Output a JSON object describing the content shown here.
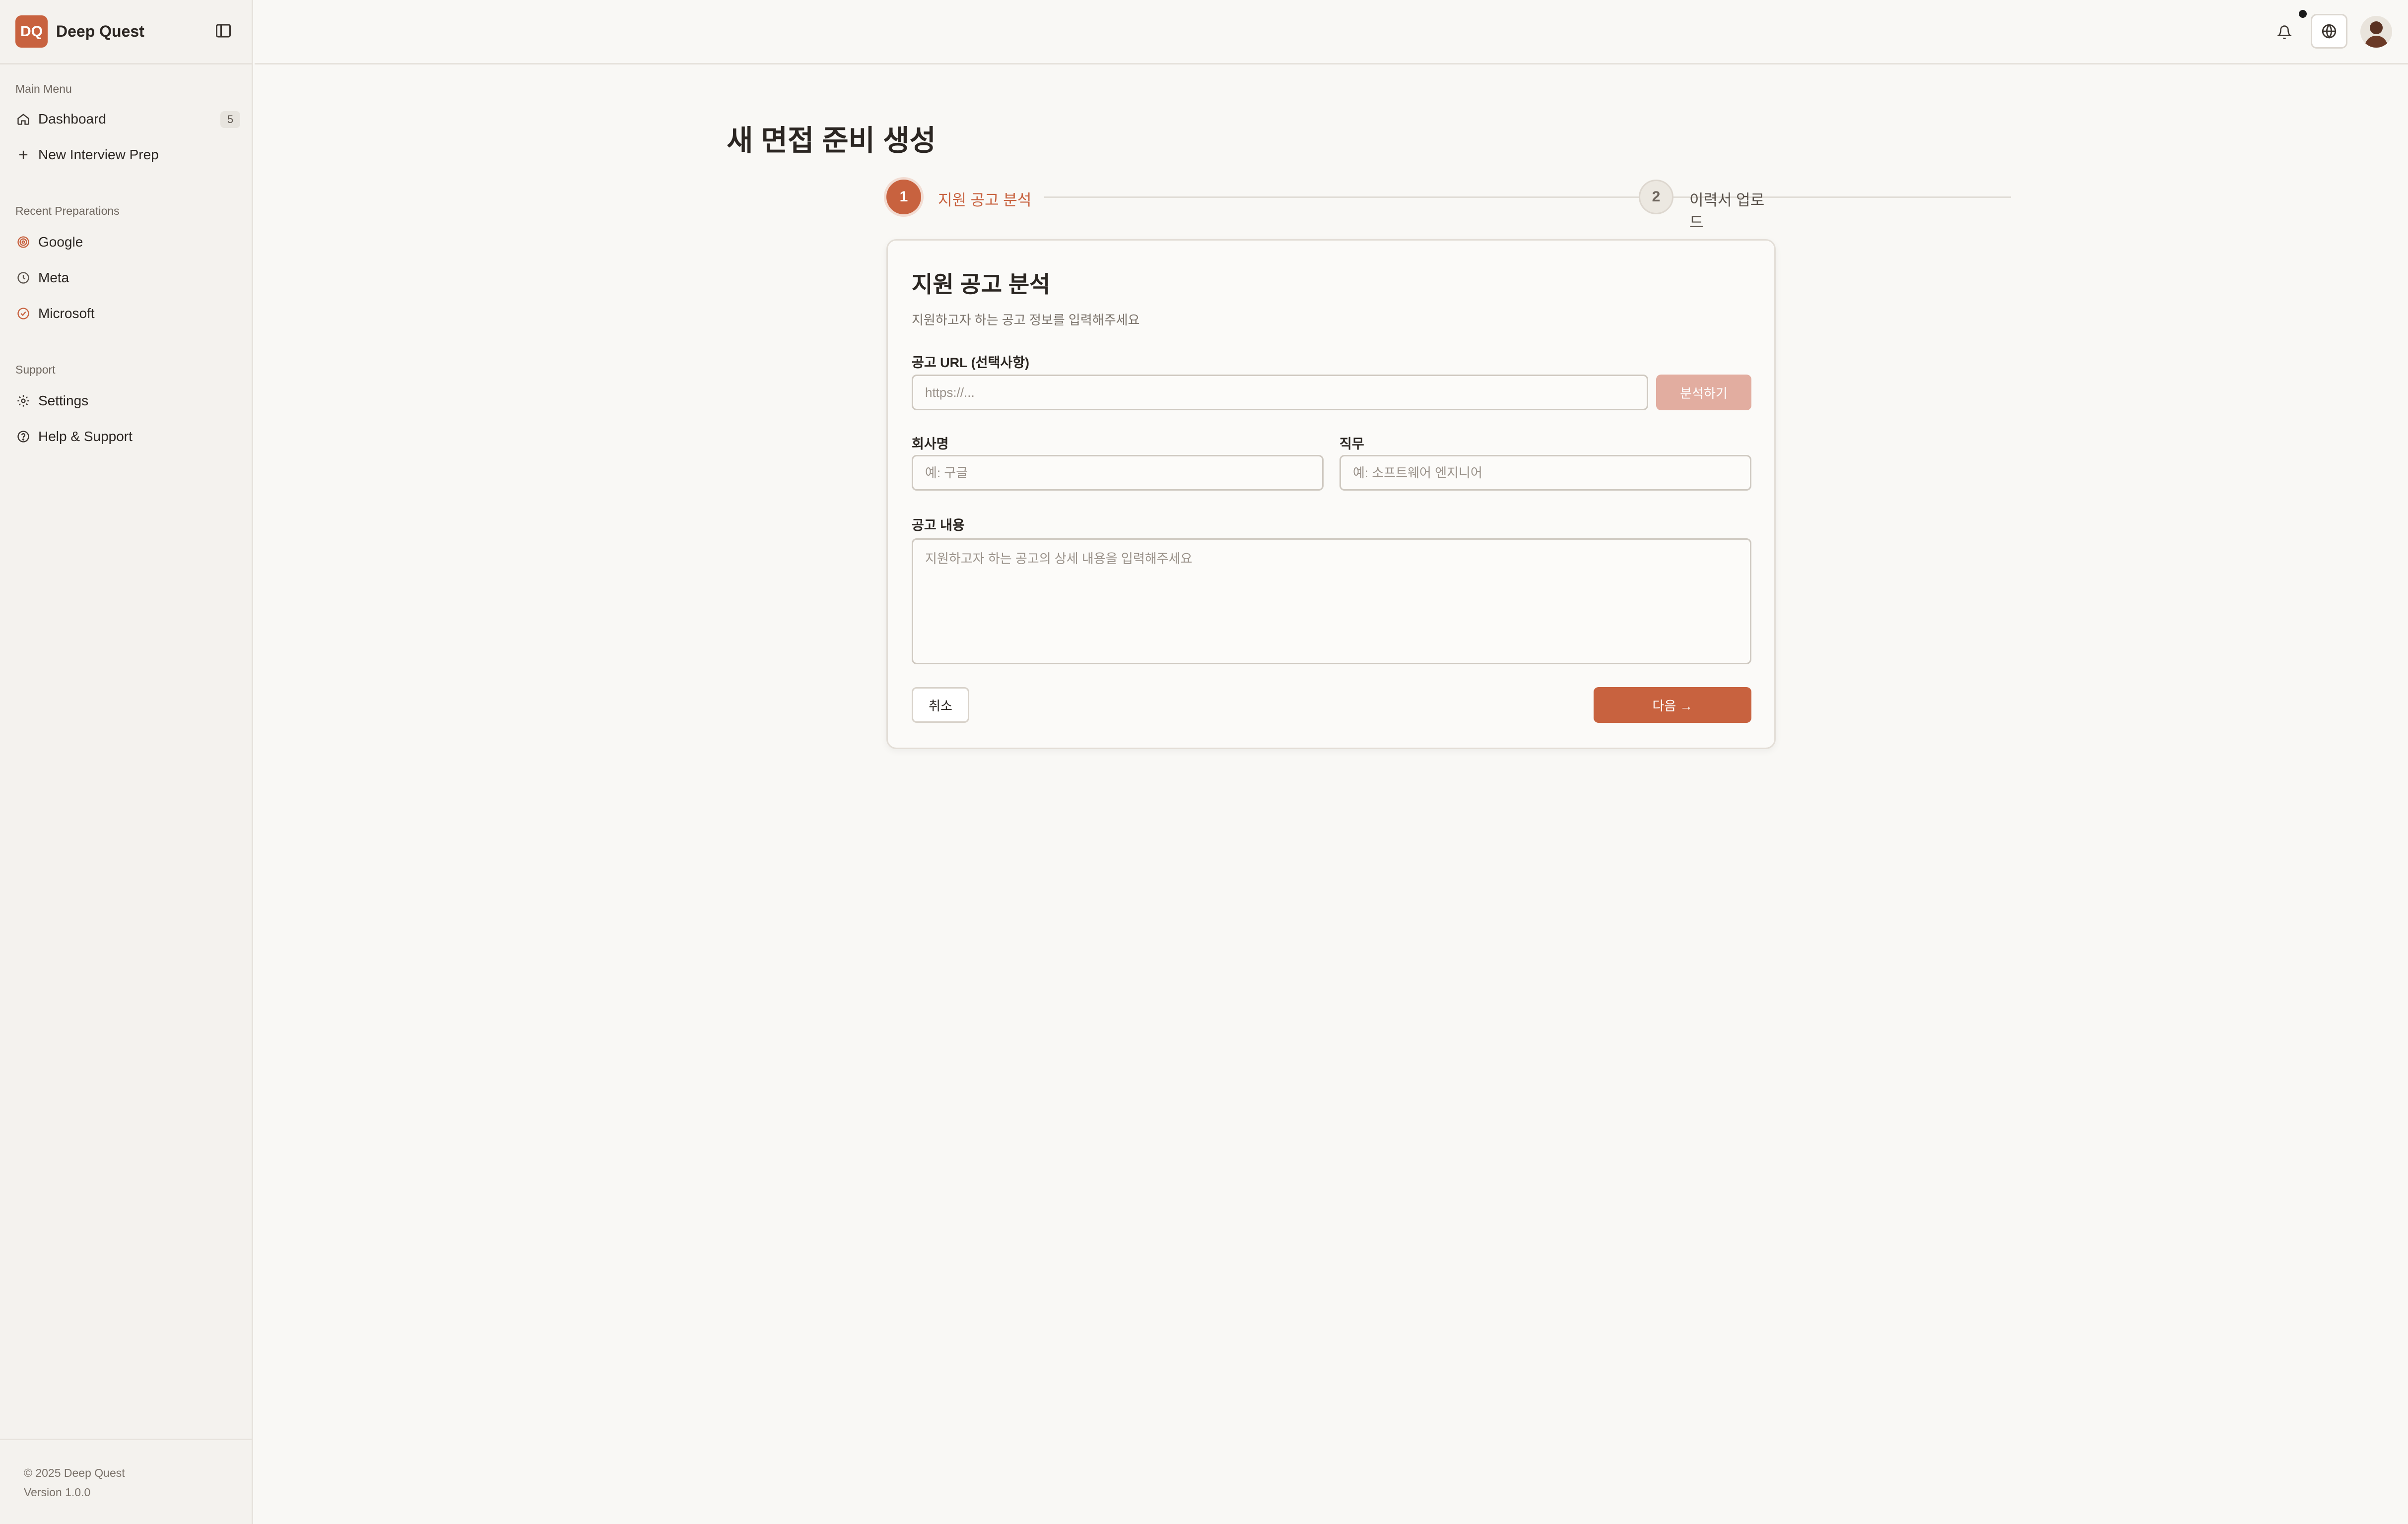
{
  "brand": {
    "logo": "DQ",
    "name": "Deep Quest"
  },
  "sidebar": {
    "main_menu_label": "Main Menu",
    "main_items": [
      {
        "label": "Dashboard",
        "icon": "home-icon",
        "badge": "5"
      },
      {
        "label": "New Interview Prep",
        "icon": "plus-icon"
      }
    ],
    "recent_label": "Recent Preparations",
    "recent_items": [
      {
        "label": "Google",
        "icon": "target-icon"
      },
      {
        "label": "Meta",
        "icon": "clock-icon"
      },
      {
        "label": "Microsoft",
        "icon": "check-circle-icon"
      }
    ],
    "support_label": "Support",
    "support_items": [
      {
        "label": "Settings",
        "icon": "gear-icon"
      },
      {
        "label": "Help & Support",
        "icon": "help-circle-icon"
      }
    ],
    "footer": {
      "copyright": "© 2025 Deep Quest",
      "version": "Version 1.0.0"
    }
  },
  "header": {
    "icons": [
      "bell-icon",
      "globe-icon",
      "avatar"
    ]
  },
  "main": {
    "title": "새 면접 준비 생성",
    "steps": [
      {
        "number": "1",
        "label": "지원 공고 분석",
        "state": "active"
      },
      {
        "number": "2",
        "label": "이력서 업로드",
        "state": "inactive"
      }
    ],
    "card": {
      "title": "지원 공고 분석",
      "subtitle": "지원하고자 하는 공고 정보를 입력해주세요",
      "url_label": "공고 URL (선택사항)",
      "url_placeholder": "https://...",
      "analyze_button": "분석하기",
      "company_label": "회사명",
      "company_placeholder": "예: 구글",
      "role_label": "직무",
      "role_placeholder": "예: 소프트웨어 엔지니어",
      "content_label": "공고 내용",
      "content_placeholder": "지원하고자 하는 공고의 상세 내용을 입력해주세요",
      "cancel_button": "취소",
      "next_button": "다음 →"
    }
  },
  "colors": {
    "accent": "#c8623f",
    "accent_light": "#e2ada0",
    "background": "#f9f8f5",
    "sidebar": "#f4f2ee"
  }
}
